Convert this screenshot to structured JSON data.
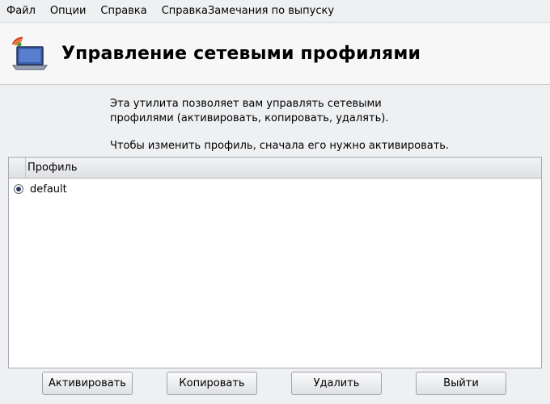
{
  "menubar": {
    "items": [
      {
        "label": "Файл"
      },
      {
        "label": "Опции"
      },
      {
        "label": "Справка"
      },
      {
        "label": "СправкаЗамечания по выпуску"
      }
    ]
  },
  "banner": {
    "icon": "network-laptop-icon",
    "title": "Управление сетевыми профилями"
  },
  "description": {
    "line1": "Эта утилита позволяет вам управлять сетевыми",
    "line2": "профилями (активировать, копировать, удалять).",
    "line3": "Чтобы изменить профиль, сначала его нужно активировать."
  },
  "table": {
    "header": "Профиль",
    "rows": [
      {
        "label": "default",
        "selected": true
      }
    ]
  },
  "buttons": {
    "activate": "Активировать",
    "copy": "Копировать",
    "delete": "Удалить",
    "exit": "Выйти"
  },
  "colors": {
    "window_bg": "#eff0f2",
    "banner_bg": "#f7f7f8",
    "radio_fill": "#24345c"
  }
}
